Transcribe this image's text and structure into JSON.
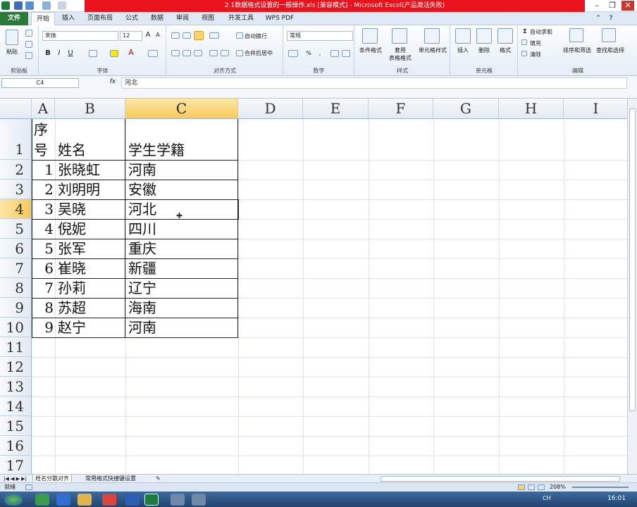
{
  "window": {
    "title": "2.1数据格式设置的一般操作.xls [兼容模式] - Microsoft Excel(产品激活失败)"
  },
  "tabs": [
    "文件",
    "开始",
    "插入",
    "页面布局",
    "公式",
    "数据",
    "审阅",
    "视图",
    "开发工具",
    "WPS PDF"
  ],
  "ribbon": {
    "clipboard": {
      "paste": "粘贴",
      "label": "剪贴板"
    },
    "font": {
      "name": "宋体",
      "size": "12",
      "bold": "B",
      "italic": "I",
      "underline": "U",
      "label": "字体"
    },
    "alignment": {
      "wrap": "自动换行",
      "merge": "合并后居中",
      "label": "对齐方式"
    },
    "number": {
      "format": "常规",
      "label": "数字"
    },
    "styles": {
      "conditional": "条件格式",
      "table_line1": "套用",
      "table_line2": "表格格式",
      "cell_styles": "单元格样式",
      "label": "样式"
    },
    "cells": {
      "insert": "插入",
      "delete": "删除",
      "format": "格式",
      "label": "单元格"
    },
    "editing": {
      "autosum": "自动求和",
      "fill": "填充",
      "clear": "清除",
      "sort": "排序和筛选",
      "find": "查找和选择",
      "label": "编辑"
    }
  },
  "formula_bar": {
    "name_box": "C4",
    "fx": "fx",
    "content": "河北"
  },
  "columns": [
    "A",
    "B",
    "C",
    "D",
    "E",
    "F",
    "G",
    "H",
    "I"
  ],
  "rows": [
    "1",
    "2",
    "3",
    "4",
    "5",
    "6",
    "7",
    "8",
    "9",
    "10",
    "11",
    "12",
    "13",
    "14",
    "15",
    "16",
    "17"
  ],
  "table": {
    "header": {
      "a_line1": "序",
      "a_line2": "号",
      "b": "姓名",
      "c": "学生学籍"
    },
    "data": [
      {
        "a": "1",
        "b": "张晓虹",
        "c": "河南"
      },
      {
        "a": "2",
        "b": "刘明明",
        "c": "安徽"
      },
      {
        "a": "3",
        "b": "吴晓",
        "c": "河北"
      },
      {
        "a": "4",
        "b": "倪妮",
        "c": "四川"
      },
      {
        "a": "5",
        "b": "张军",
        "c": "重庆"
      },
      {
        "a": "6",
        "b": "崔晓",
        "c": "新疆"
      },
      {
        "a": "7",
        "b": "孙莉",
        "c": "辽宁"
      },
      {
        "a": "8",
        "b": "苏超",
        "c": "海南"
      },
      {
        "a": "9",
        "b": "赵宁",
        "c": "河南"
      }
    ]
  },
  "sheets": [
    "姓名分散对齐",
    "常用格式快捷键设置"
  ],
  "status": {
    "ready": "就绪",
    "zoom": "208%"
  },
  "taskbar": {
    "ime": "CH",
    "clock": "16:01"
  }
}
